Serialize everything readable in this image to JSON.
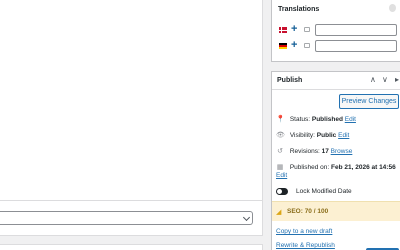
{
  "translations": {
    "title": "Translations",
    "languages": [
      {
        "flag": "danish-flag"
      },
      {
        "flag": "german-flag"
      }
    ]
  },
  "publish": {
    "title": "Publish",
    "preview_button": "Preview Changes",
    "status_label": "Status:",
    "status_value": "Published",
    "status_edit": "Edit",
    "visibility_label": "Visibility:",
    "visibility_value": "Public",
    "visibility_edit": "Edit",
    "revisions_label": "Revisions:",
    "revisions_value": "17",
    "revisions_browse": "Browse",
    "published_label": "Published on:",
    "published_value": "Feb 21, 2026 at 14:56",
    "published_edit": "Edit",
    "lock_label": "Lock Modified Date",
    "seo_label": "SEO: 70 / 100",
    "copy_link": "Copy to a new draft",
    "rewrite_link": "Rewrite & Republish"
  },
  "colors": {
    "accent": "#2271b1",
    "seo_background": "#fcf0d2",
    "seo_text": "#8a6d1a"
  }
}
